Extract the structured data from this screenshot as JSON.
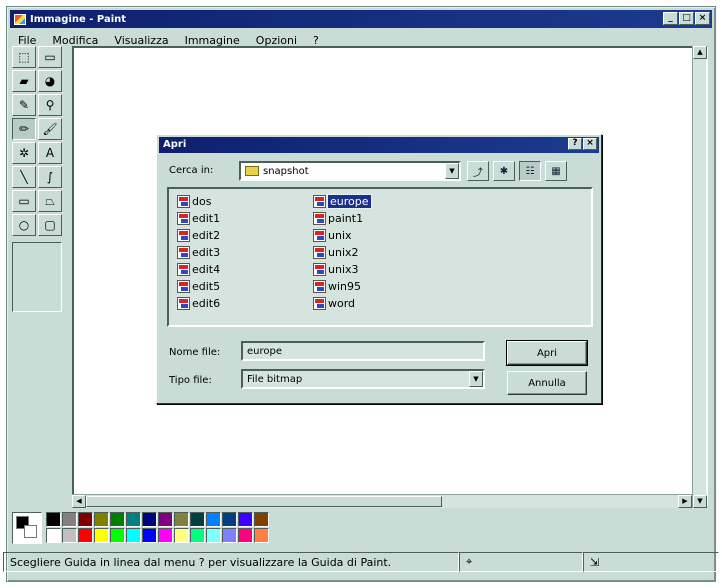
{
  "window": {
    "title": "Immagine - Paint",
    "buttons": [
      "_",
      "□",
      "×"
    ]
  },
  "menu": [
    {
      "label": "File"
    },
    {
      "label": "Modifica"
    },
    {
      "label": "Visualizza"
    },
    {
      "label": "Immagine"
    },
    {
      "label": "Opzioni"
    },
    {
      "label": "?"
    }
  ],
  "tools": [
    {
      "name": "free-select-icon",
      "glyph": "⬚"
    },
    {
      "name": "rect-select-icon",
      "glyph": "▭"
    },
    {
      "name": "eraser-icon",
      "glyph": "▰"
    },
    {
      "name": "fill-bucket-icon",
      "glyph": "◕"
    },
    {
      "name": "color-picker-icon",
      "glyph": "✎"
    },
    {
      "name": "magnifier-icon",
      "glyph": "⚲"
    },
    {
      "name": "pencil-icon",
      "glyph": "✏"
    },
    {
      "name": "brush-icon",
      "glyph": "🖌"
    },
    {
      "name": "airbrush-icon",
      "glyph": "✲"
    },
    {
      "name": "text-icon",
      "glyph": "A"
    },
    {
      "name": "line-icon",
      "glyph": "╲"
    },
    {
      "name": "curve-icon",
      "glyph": "∫"
    },
    {
      "name": "rectangle-icon",
      "glyph": "▭"
    },
    {
      "name": "polygon-icon",
      "glyph": "⏢"
    },
    {
      "name": "ellipse-icon",
      "glyph": "○"
    },
    {
      "name": "rounded-rect-icon",
      "glyph": "▢"
    }
  ],
  "palette": {
    "top": [
      "#000000",
      "#808080",
      "#800000",
      "#808000",
      "#008000",
      "#008080",
      "#000080",
      "#800080",
      "#808040",
      "#004040",
      "#0080ff",
      "#004080",
      "#4000ff",
      "#804000"
    ],
    "bottom": [
      "#ffffff",
      "#c0c0c0",
      "#ff0000",
      "#ffff00",
      "#00ff00",
      "#00ffff",
      "#0000ff",
      "#ff00ff",
      "#ffff80",
      "#00ff80",
      "#80ffff",
      "#8080ff",
      "#ff0080",
      "#ff8040"
    ]
  },
  "status": {
    "text": "Scegliere Guida in linea dal menu ? per visualizzare la Guida di Paint."
  },
  "dialog": {
    "title": "Apri",
    "title_buttons": [
      "?",
      "×"
    ],
    "look_in_label": "Cerca in:",
    "look_in_value": "snapshot",
    "files_col1": [
      "dos",
      "edit1",
      "edit2",
      "edit3",
      "edit4",
      "edit5",
      "edit6"
    ],
    "files_col2": [
      "europe",
      "paint1",
      "unix",
      "unix2",
      "unix3",
      "win95",
      "word"
    ],
    "selected_file": "europe",
    "filename_label": "Nome file:",
    "filename_value": "europe",
    "filetype_label": "Tipo file:",
    "filetype_value": "File bitmap",
    "open_button": "Apri",
    "cancel_button": "Annulla"
  }
}
